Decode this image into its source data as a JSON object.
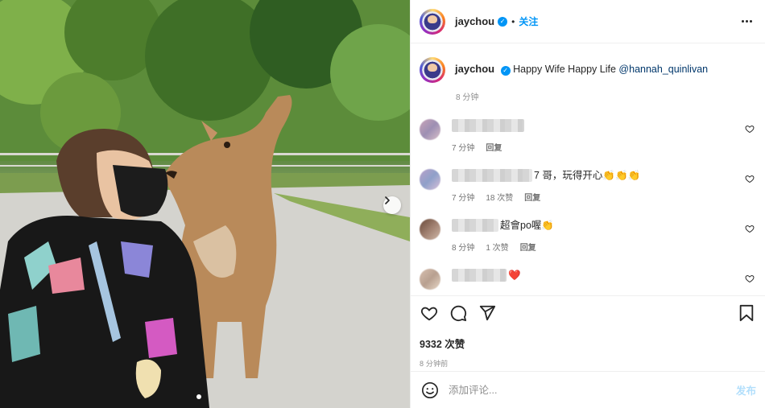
{
  "post": {
    "username": "jaychou",
    "separator": "•",
    "follow_label": "关注",
    "caption_text": "Happy Wife Happy Life",
    "caption_mention": "@hannah_quinlivan",
    "caption_time": "8 分钟"
  },
  "comments": [
    {
      "text": "",
      "time": "7 分钟",
      "likes": "",
      "reply": "回复"
    },
    {
      "text": "7 哥，玩得开心👏👏👏",
      "time": "7 分钟",
      "likes": "18 次赞",
      "reply": "回复"
    },
    {
      "text": "超會po喔👏",
      "time": "8 分钟",
      "likes": "1 次赞",
      "reply": "回复"
    },
    {
      "text": "❤️",
      "time": "",
      "likes": "",
      "reply": ""
    }
  ],
  "stats": {
    "likes": "9332 次赞",
    "posted": "8 分钟前"
  },
  "comment_input": {
    "placeholder": "添加评论...",
    "post_label": "发布"
  },
  "colors": {
    "accent": "#0095f6",
    "post_disabled": "#b2dffc",
    "heart": "#ed4956"
  }
}
